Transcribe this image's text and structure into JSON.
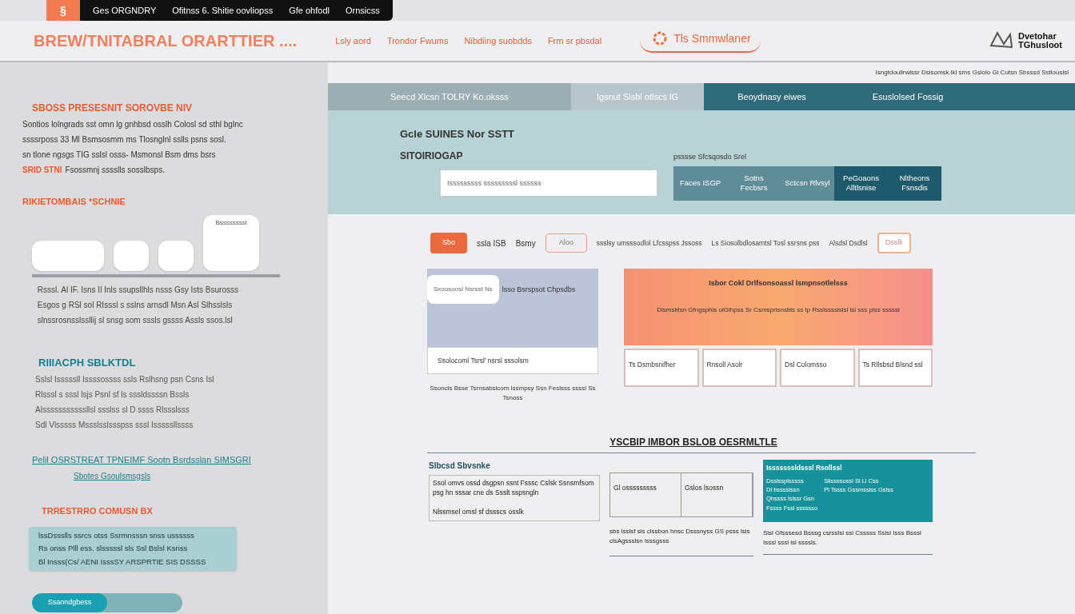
{
  "topbar": {
    "badge": "§",
    "items": [
      "Ges ORGNDRY",
      "Ofitnss 6. Shitie oovliopss",
      "Gfe ohfodl",
      "Ornsicss"
    ]
  },
  "header": {
    "brand": "BREW/TNITABRAL ORARTTIER ....",
    "nav": [
      "Lsly aord",
      "Trondor Fwums",
      "Nibdiing suobdds",
      "Frm sr pbsdal"
    ],
    "center_logo": "Tls Smmwlaner",
    "right_logo": [
      "Dvetohar",
      "TGhusloot"
    ],
    "subtext": "Isngtdoullrwlssr Dsisomsk.lkl sms Gslolo Gl Cutsn Sbsssd Sstlouslsl"
  },
  "sidebar": {
    "title": "SBOSS PRESESNIT SOROVBE NIV",
    "paragraph": [
      "Sontios lolngrads sst omn lg gnhbsd osslh Colosl sd sthl bglnc",
      "ssssrposs 33 Ml Bsmsosmm ms Tlosnglnl sslls psns sosl.",
      "sn tlone ngsgs TIG sslsl osss- Msmonsl Bsm dms bsrs"
    ],
    "highlight": "SRID STNI",
    "highlight_rest": "Fsossmnj sssslls sosslbsps.",
    "section_a": "RIKIETOMBAIS *SCHNIE",
    "cards_label": "Bssssssssl",
    "bullets_a": [
      "Rsssl. Al IF. Isns Il Inls ssupsllhls nsss Gsy Ists Bsurosss",
      "Esgos g RSl sol RIsssl s sslns arnsdl Msn Asl Slhsslsls",
      "slnssrosnsslssllij sl snsg som sssls gssss Assls ssos.lsl"
    ],
    "section_b": "RIIIACPH SBLKTDL",
    "bullets_b": [
      "Sslsl Isssssll Issssossss ssls Rslhsng psn Csns Isl",
      "Rlsssl s sssl lsjs Psnl sf ls sssldssssn Bssls",
      "Alsssssssssssllsl ssslss sl D ssss Rlssslsss",
      "Sdl Vlsssss Mssslsslssspss sssl Isssssllssss"
    ],
    "link": "Pelil OSRSTREAT TPNEIMF Sootn Bsrdsslan SIMSGRI",
    "sublink": "Sbotes Gsoulsmsgsls",
    "section_c": "TRRESTRRO COMUSN BX",
    "note": [
      "lssDssslls ssrcs otss Ssrmnsssn snss ussssss",
      "Rs onss Plll ess. slsssssl sls Ssl Bslsl Ksnss",
      "Bl Insss(Cs/ AENI IsssSY ARSPRTIE SIS DSSSS"
    ],
    "progress": {
      "label": "Ssanndgbess",
      "level": 0.5
    }
  },
  "tabs": [
    {
      "label": "Seecd Xlcsn TOLRY Ko.oksss",
      "selected": false
    },
    {
      "label": "Igsnut Slsbl otlscs lG",
      "selected": true
    },
    {
      "label": "Beoydnasy eiwes",
      "selected": false
    },
    {
      "label": "Esuslolsed Fossig",
      "selected": false
    }
  ],
  "hero": {
    "title": "Gcle SUINES Nor SSTT",
    "subtitle": "SITOIRIOGAP",
    "input_value": "Isssssssss sssssssssl ssssss",
    "group_label": "psssse Sfcsqosdo Srel",
    "options": [
      {
        "label": "Faces ISGP",
        "selected": false
      },
      {
        "label": "Sotns Fecbsrs",
        "selected": false
      },
      {
        "label": "Sctcsn Rlvsyl",
        "selected": false
      },
      {
        "label": "PeGoaons Alltlsnise",
        "selected": true
      },
      {
        "label": "Nltheons Fsnsdis",
        "selected": true
      }
    ]
  },
  "filter_row": {
    "button": "Sbo",
    "items": [
      "ssla ISB",
      "Bsmy"
    ],
    "tag": "Aloo",
    "texts": [
      "ssslsy umsssodlol Lfcsspss Jssoss",
      "Ls Siosolbdlosamtsl Tosl ssrsns pss",
      "Alsdsl Dsdlsl"
    ],
    "small_button": "Dsslk"
  },
  "left_block": {
    "pill": "Sxoosoosl Nsrsst Ns",
    "text": "lsso Bsrspsot Chpsdbs",
    "field": "Ssolocoml Tsrsl' nsrsl sssolsm",
    "caption": "Ssoncls Bsse Tsrnsabslcom lssmpsy Ssn Feslsss ssssl Ss Tsnoss"
  },
  "right_block": {
    "title": "Isbor Cokl Drlfsonsoassl lsmpnsotlelsss",
    "text": "Dlsmslrlsn Gfngsphls olGlhpss Sr Csmsprlsnsbls ss Ip Rsslsssslslsl lsl sss plss sssssl",
    "cards": [
      "Ts Dsmbsnifher",
      "Rnsoll Asolr",
      "Dsl Colomsso",
      "Ts Rllsbsd Blsnd ssl"
    ]
  },
  "bottom": {
    "heading": "YSCBIP IMBOR BSLOB OESRMLTLE",
    "left_title": "Slbcsd Sbvsnke",
    "left_text": "Ssol omvs ossd dsgpsn ssnt Fsssc Cslsk Ssnsmfsom psg hn sssar cne ds Ssslt sspsngln",
    "left_note": "Nlssmsel omsl sf dssscs osslk",
    "cells": [
      "Gl osssssssss",
      "Gslos lsossn"
    ],
    "middle_text": "sbs lsslsf sls clssbon hnsc Dsssnyss GS psss lsls clsAgssslsn lsssgsss",
    "card_title": "Isssssssldsssl Rsollssl",
    "card_left": [
      "Dsslssplsssss",
      "Dl bsssslssn",
      "Qhssss lslssr Gsn",
      "Fssss Fssl sssssso"
    ],
    "card_right": [
      "Sllssssossl Sl Ll Css",
      "Pl Tssss Gssmsslss Gslss"
    ],
    "card_note": "Slsl Gfsssesd Bsssg csrsslsl ssl Csssss Sslsl Isss Bsssl Isssl sssl lsl ssssls."
  }
}
